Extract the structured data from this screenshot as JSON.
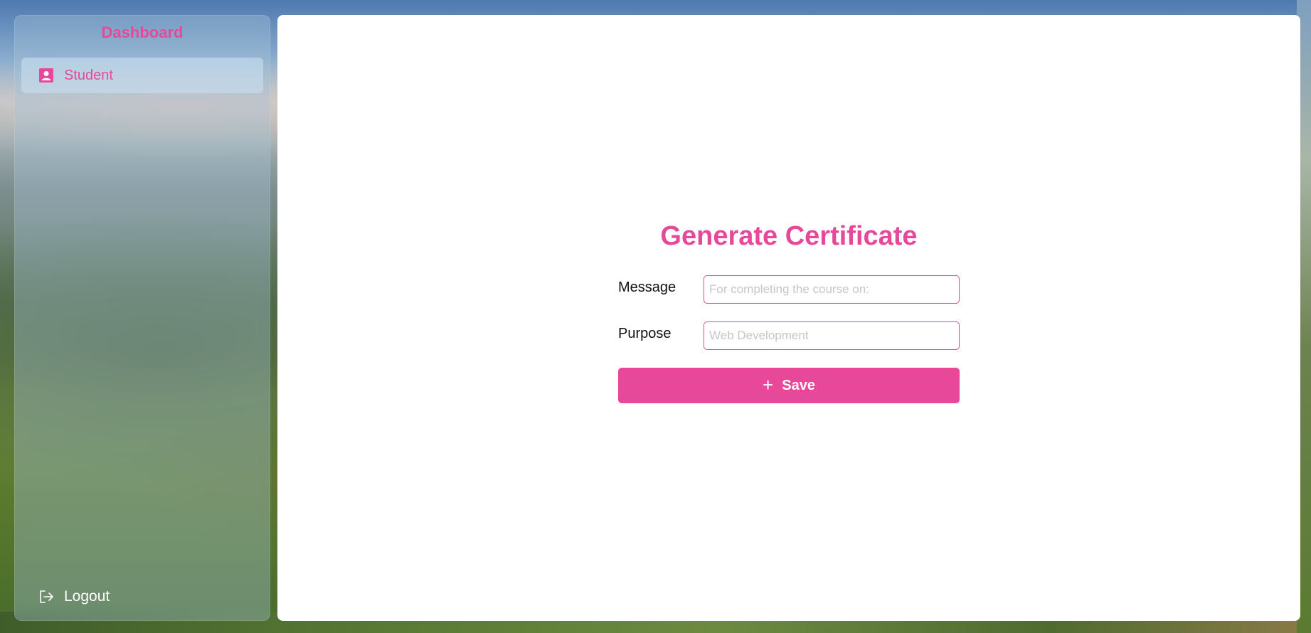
{
  "sidebar": {
    "title": "Dashboard",
    "items": [
      {
        "label": "Student",
        "icon": "user-badge-icon"
      }
    ],
    "logout": {
      "label": "Logout",
      "icon": "logout-icon"
    }
  },
  "form": {
    "title": "Generate Certificate",
    "message": {
      "label": "Message",
      "placeholder": "For completing the course on:",
      "value": ""
    },
    "purpose": {
      "label": "Purpose",
      "placeholder": "Web Development",
      "value": ""
    },
    "save_label": "Save",
    "save_icon": "plus-icon"
  },
  "colors": {
    "accent": "#e8489a",
    "panel": "#ffffff"
  }
}
